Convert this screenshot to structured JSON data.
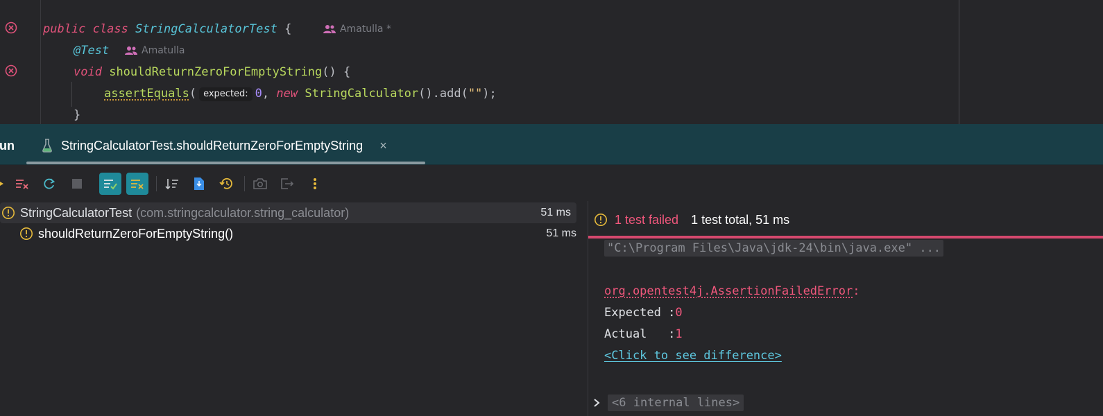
{
  "editor": {
    "line1": {
      "kw1": "public",
      "kw2": "class",
      "class_name": "StringCalculatorTest",
      "brace": "{",
      "author": "Amatulla *"
    },
    "line2": {
      "annotation": "@Test",
      "author": "Amatulla"
    },
    "line3": {
      "kw": "void",
      "method": "shouldReturnZeroForEmptyString",
      "punc": "() {"
    },
    "line4": {
      "call": "assertEquals",
      "open": "(",
      "hint": "expected:",
      "value": "0",
      "comma": ",",
      "kw": "new",
      "type": "StringCalculator",
      "rest": "().add(",
      "str": "\"\"",
      "close": ");"
    },
    "line5": {
      "brace": "}"
    }
  },
  "run_panel": {
    "title": "Run",
    "tab_label": "StringCalculatorTest.shouldReturnZeroForEmptyString",
    "close_glyph": "×"
  },
  "toolbar": {
    "buttons": [
      "rerun-icon",
      "rerun-failed-icon",
      "restart-icon",
      "stop-icon",
      "show-passed-icon",
      "show-ignored-icon",
      "sort-icon",
      "import-tests-icon",
      "history-icon",
      "screenshot-icon",
      "export-icon",
      "more-icon"
    ]
  },
  "tree": {
    "root": {
      "label": "StringCalculatorTest",
      "package": "(com.stringcalculator.string_calculator)",
      "time": "51 ms"
    },
    "child": {
      "label": "shouldReturnZeroForEmptyString()",
      "time": "51 ms"
    }
  },
  "console": {
    "failed_text": "1 test failed",
    "total_text": "1 test total, 51 ms",
    "command": "\"C:\\Program Files\\Java\\jdk-24\\bin\\java.exe\" ...",
    "error_class": "org.opentest4j.AssertionFailedError",
    "error_colon": ":",
    "expected_label": "Expected :",
    "expected_value": "0",
    "actual_label": "Actual   :",
    "actual_value": "1",
    "diff_link": "<Click to see difference>",
    "internal_lines": "<6 internal lines>"
  },
  "colors": {
    "accent_teal": "#1f8a9a",
    "failure": "#f0577c",
    "warning": "#e5b93b"
  }
}
